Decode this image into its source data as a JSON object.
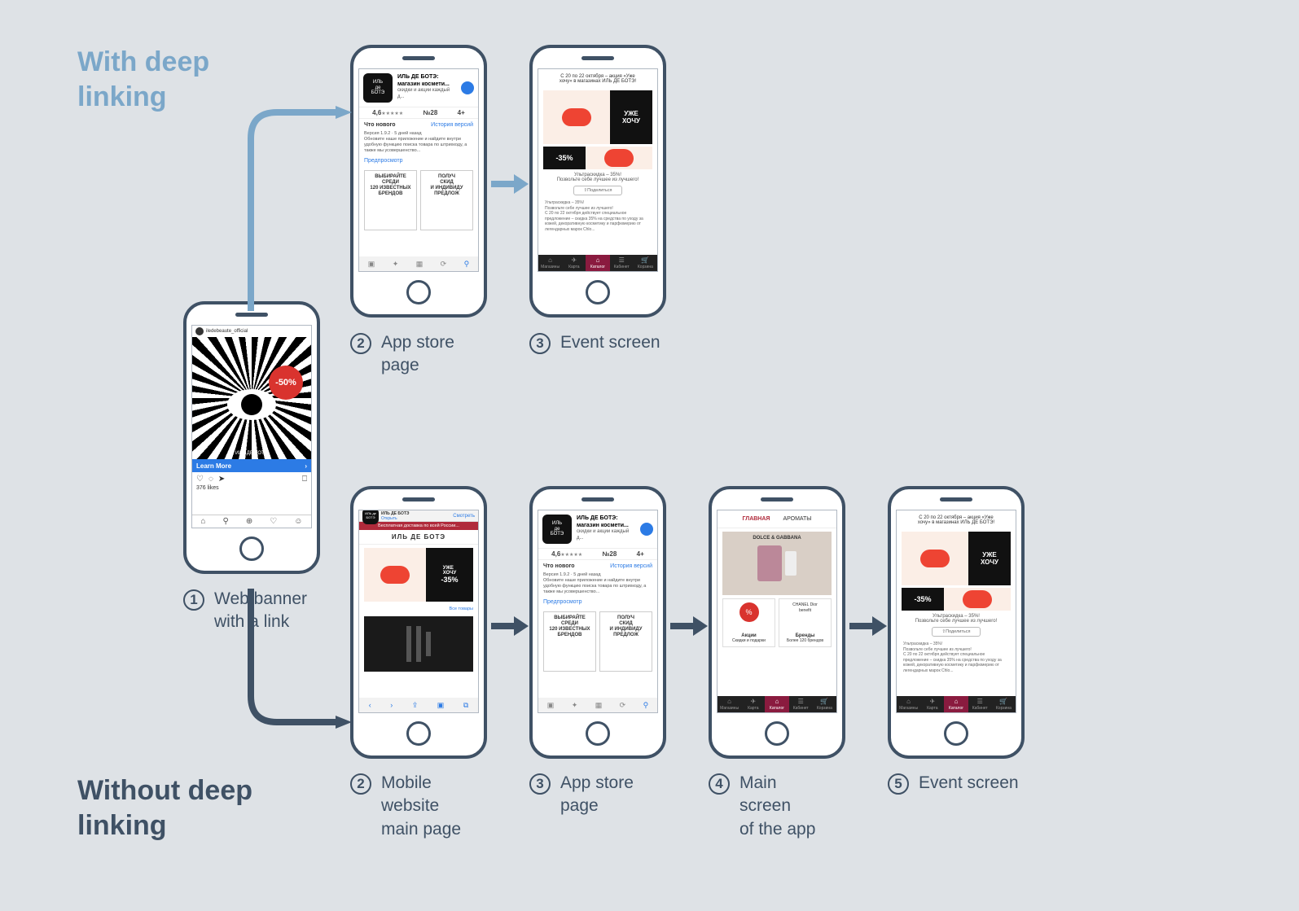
{
  "titles": {
    "with": "With deep\nlinking",
    "without": "Without deep\nlinking"
  },
  "step1": {
    "num": "1",
    "label": "Web banner\nwith a link"
  },
  "with_steps": [
    {
      "num": "2",
      "label": "App store\npage"
    },
    {
      "num": "3",
      "label": "Event screen"
    }
  ],
  "without_steps": [
    {
      "num": "2",
      "label": "Mobile\nwebsite\nmain page"
    },
    {
      "num": "3",
      "label": "App store\npage"
    },
    {
      "num": "4",
      "label": "Main\nscreen\nof the app"
    },
    {
      "num": "5",
      "label": "Event screen"
    }
  ],
  "ig": {
    "account": "iledebeaute_official",
    "badge": "-50%",
    "brand": "ИЛЬ ДЕ БОТЭ",
    "learn": "Learn More",
    "likes": "376 likes"
  },
  "appstore": {
    "logo": "ИЛЬ\nде\nБОТЭ",
    "title": "ИЛЬ ДЕ БОТЭ:\nмагазин космети...",
    "subtitle": "скидки и акции каждый д...",
    "rating": "4,6",
    "rank_no": "№28",
    "age": "4+",
    "whats_new": "Что нового",
    "history": "История версий",
    "version": "Версия 1.9.2",
    "ago": "5 дней назад",
    "desc": "Обновите наше приложение и найдите внутри удобную функцию поиска товара по штрихкоду, а также мы усовершенство...",
    "preview": "Предпросмотр",
    "p1": "ВЫБИРАЙТЕ\nСРЕДИ\n120 ИЗВЕСТНЫХ\nБРЕНДОВ",
    "p2": "ПОЛУЧ\nСКИД\nИ ИНДИВИДУ\nПРЕДЛОЖ"
  },
  "event": {
    "header": "С 20 по 22 октября – акция «Уже\nхочу» в магазинах ИЛЬ ДЕ БОТЭ!",
    "want": "УЖЕ\nХОЧУ",
    "disc": "-35%",
    "sub1": "Ультраскидка – 35%!",
    "sub2": "Позвольте себе лучшее из лучшего!",
    "share": "Поделиться",
    "body": "Ультраскидка – 35%!\nПозвольте себе лучшее из лучшего!\nС 20 по 22 октября действует специальное предложение – скидка 35% на средства по уходу за кожей, декоративную косметику и парфюмерию от легендарных марок Chlo..."
  },
  "apptabs": [
    "Магазины",
    "Карта",
    "Каталог",
    "Кабинет",
    "Корзина"
  ],
  "apptab_icons": [
    "⌂",
    "✈",
    "⌂",
    "☰",
    "🛒"
  ],
  "mw": {
    "open": "Открыть",
    "view": "Смотреть",
    "banner": "Бесплатная доставка по всей России...",
    "brand": "ИЛЬ ДЕ БОТЭ",
    "want": "УЖЕ\nХОЧУ",
    "disc": "-35%",
    "all": "Все товары"
  },
  "main": {
    "tab1": "ГЛАВНАЯ",
    "tab2": "АРОМАТЫ",
    "dg": "DOLCE & GABBANA",
    "pct": "%",
    "c1t": "Акции",
    "c1s": "Скидки и подарки",
    "c2a": "CHANEL",
    "c2b": "Dior",
    "c2c": "benefit",
    "c2t": "Бренды",
    "c2s": "Более 120 брендов"
  }
}
